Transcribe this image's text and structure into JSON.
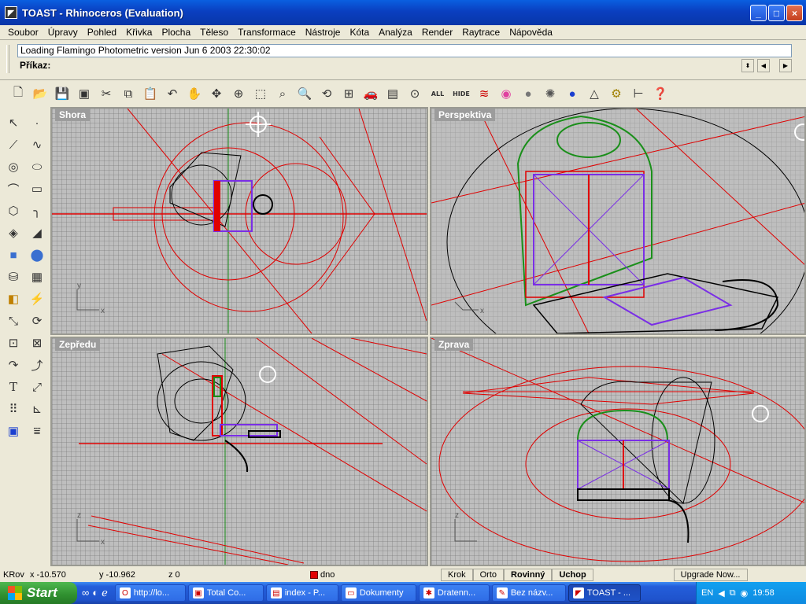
{
  "window": {
    "title": "TOAST - Rhinoceros (Evaluation)",
    "minimize": "_",
    "maximize": "□",
    "close": "×"
  },
  "menu": [
    "Soubor",
    "Úpravy",
    "Pohled",
    "Křivka",
    "Plocha",
    "Těleso",
    "Transformace",
    "Nástroje",
    "Kóta",
    "Analýza",
    "Render",
    "Raytrace",
    "Nápověda"
  ],
  "command": {
    "history": "Loading Flamingo Photometric version Jun  6 2003 22:30:02",
    "prompt_label": "Příkaz:"
  },
  "toolbar": {
    "text_buttons": [
      "ALL",
      "HIDE"
    ]
  },
  "viewports": {
    "top": "Shora",
    "perspective": "Perspektiva",
    "front": "Zepředu",
    "right": "Zprava"
  },
  "axes": {
    "x": "x",
    "y": "y",
    "z": "z"
  },
  "statusbar": {
    "cplane": "KRov",
    "x": "x -10.570",
    "y": "y -10.962",
    "z": "z 0",
    "layer": "dno",
    "buttons": [
      "Krok",
      "Orto",
      "Rovinný",
      "Uchop"
    ],
    "upgrade": "Upgrade Now..."
  },
  "taskbar": {
    "start": "Start",
    "tasks": [
      "http://lo...",
      "Total Co...",
      "index - P...",
      "Dokumenty",
      "Dratenn...",
      "Bez názv...",
      "TOAST - ..."
    ],
    "lang": "EN",
    "clock": "19:58"
  },
  "colors": {
    "accent_red": "#e00000",
    "wire_green": "#1a8f1a",
    "wire_purple": "#7a2ee6",
    "viewport_bg": "#bebebe"
  }
}
